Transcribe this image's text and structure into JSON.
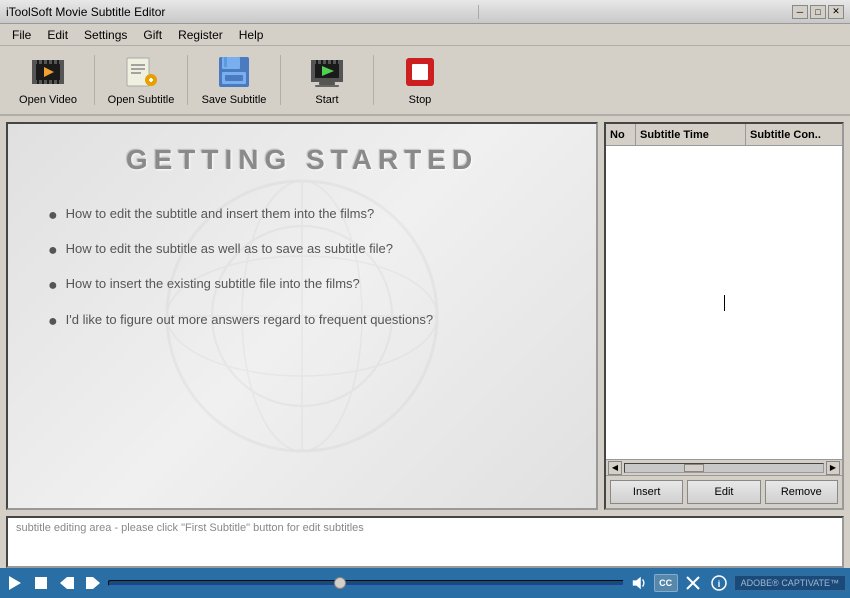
{
  "window": {
    "title": "iToolSoft Movie Subtitle Editor",
    "min_btn": "─",
    "max_btn": "□",
    "close_btn": "✕"
  },
  "menu": {
    "items": [
      "File",
      "Edit",
      "Settings",
      "Gift",
      "Register",
      "Help"
    ]
  },
  "toolbar": {
    "buttons": [
      {
        "id": "open-video",
        "label": "Open Video"
      },
      {
        "id": "open-subtitle",
        "label": "Open Subtitle"
      },
      {
        "id": "save-subtitle",
        "label": "Save Subtitle"
      },
      {
        "id": "start",
        "label": "Start"
      },
      {
        "id": "stop",
        "label": "Stop"
      }
    ]
  },
  "preview": {
    "title": "GETTING  STARTED",
    "items": [
      "How to edit the subtitle and insert them into the films?",
      "How to edit the subtitle as well as to save as subtitle file?",
      "How to insert the existing subtitle file into the films?",
      "I'd like to figure out more answers regard to frequent questions?"
    ]
  },
  "subtitle_panel": {
    "col_no": "No",
    "col_time": "Subtitle Time",
    "col_content": "Subtitle Con..",
    "actions": {
      "insert": "Insert",
      "edit": "Edit",
      "remove": "Remove"
    }
  },
  "edit_area": {
    "placeholder": "subtitle editing area - please click \"First Subtitle\" button for edit subtitles"
  },
  "playback": {
    "captivate_label": "ADOBE® CAPTIVATE™"
  },
  "colors": {
    "toolbar_bg": "#d4d0c8",
    "playback_bg": "#2a6ea6",
    "preview_text": "#7a7a7a"
  }
}
